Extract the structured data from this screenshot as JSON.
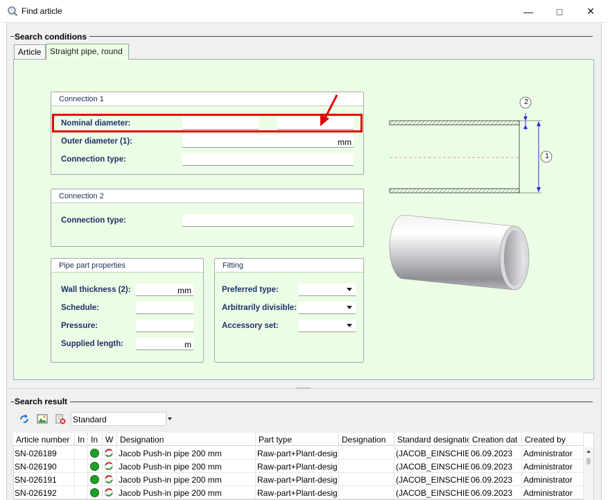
{
  "window": {
    "title": "Find article"
  },
  "search_conditions": {
    "title": "Search conditions",
    "tabs": [
      {
        "label": "Article"
      },
      {
        "label": "Straight pipe, round"
      }
    ],
    "connection1": {
      "title": "Connection 1",
      "nominal_diameter": {
        "label": "Nominal diameter:",
        "value1": "",
        "value2": ""
      },
      "outer_diameter": {
        "label": "Outer diameter (1):",
        "unit": "mm"
      },
      "connection_type": {
        "label": "Connection type:",
        "value": ""
      }
    },
    "connection2": {
      "title": "Connection 2",
      "connection_type": {
        "label": "Connection type:",
        "value": ""
      }
    },
    "pipe_part": {
      "title": "Pipe part properties",
      "wall_thickness": {
        "label": "Wall thickness (2):",
        "unit": "mm"
      },
      "schedule": {
        "label": "Schedule:",
        "value": ""
      },
      "pressure": {
        "label": "Pressure:",
        "value": ""
      },
      "supplied_length": {
        "label": "Supplied length:",
        "unit": "m"
      }
    },
    "fitting": {
      "title": "Fitting",
      "preferred_type": {
        "label": "Preferred type:",
        "value": ""
      },
      "arbitrarily_divisible": {
        "label": "Arbitrarily divisible:",
        "value": ""
      },
      "accessory_set": {
        "label": "Accessory set:",
        "value": ""
      }
    },
    "diagram": {
      "callout1": "1",
      "callout2": "2"
    }
  },
  "search_result": {
    "title": "Search result",
    "view_select": "Standard",
    "columns": [
      "Article number",
      "In",
      "In",
      "W",
      "Designation",
      "Part type",
      "Designation",
      "Standard designatio",
      "Creation dat",
      "Created by"
    ],
    "rows": [
      {
        "article": "SN-026189",
        "designation": "Jacob Push-in pipe 200 mm",
        "part_type": "Raw-part+Plant-desig",
        "designation2": "",
        "standard": "(JACOB_EINSCHIEBR",
        "created": "06.09.2023",
        "by": "Administrator"
      },
      {
        "article": "SN-026190",
        "designation": "Jacob Push-in pipe 200 mm",
        "part_type": "Raw-part+Plant-desig",
        "designation2": "",
        "standard": "(JACOB_EINSCHIEBR",
        "created": "06.09.2023",
        "by": "Administrator"
      },
      {
        "article": "SN-026191",
        "designation": "Jacob Push-in pipe 200 mm",
        "part_type": "Raw-part+Plant-desig",
        "designation2": "",
        "standard": "(JACOB_EINSCHIEBR",
        "created": "06.09.2023",
        "by": "Administrator"
      },
      {
        "article": "SN-026192",
        "designation": "Jacob Push-in pipe 200 mm",
        "part_type": "Raw-part+Plant-desig",
        "designation2": "",
        "standard": "(JACOB_EINSCHIEBR",
        "created": "06.09.2023",
        "by": "Administrator"
      }
    ]
  },
  "colors": {
    "panel_bg": "#ecfde6",
    "label_text": "#1f2f6b",
    "highlight": "#e10000",
    "status_green": "#1f9e2a"
  },
  "icons": [
    "app-search-icon",
    "minimize-icon",
    "maximize-icon",
    "close-icon",
    "refresh-icon",
    "image-icon",
    "delete-icon",
    "status-dot-icon",
    "swap-arrows-icon"
  ]
}
